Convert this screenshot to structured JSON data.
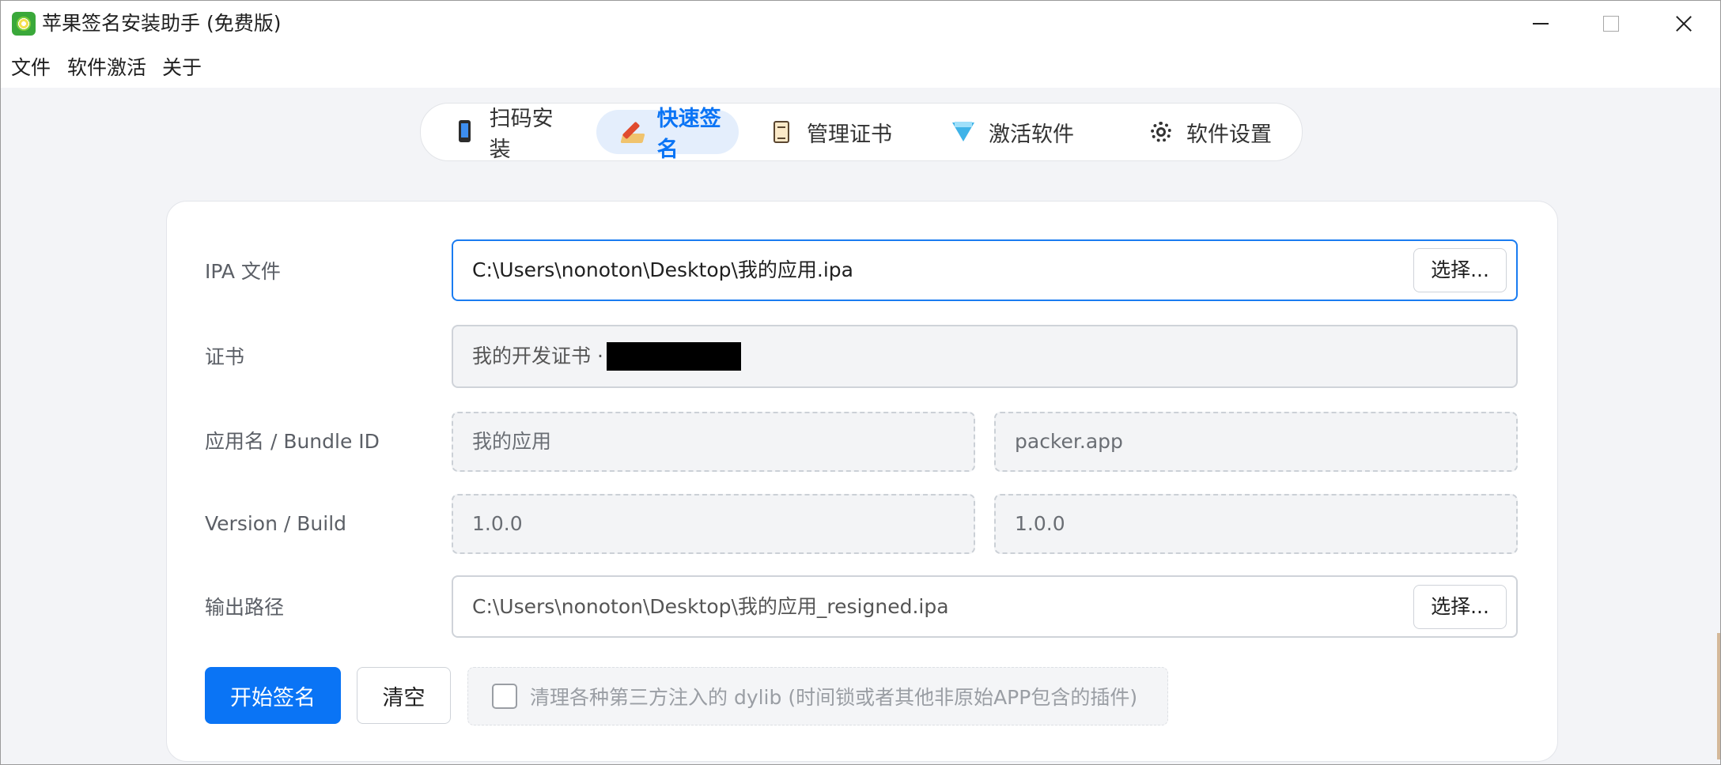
{
  "window": {
    "title": "苹果签名安装助手 (免费版)"
  },
  "menu": [
    "文件",
    "软件激活",
    "关于"
  ],
  "tabs": [
    {
      "label": "扫码安装",
      "icon": "phone-icon",
      "active": false
    },
    {
      "label": "快速签名",
      "icon": "pen-signature-icon",
      "active": true
    },
    {
      "label": "管理证书",
      "icon": "scroll-icon",
      "active": false
    },
    {
      "label": "激活软件",
      "icon": "diamond-icon",
      "active": false
    },
    {
      "label": "软件设置",
      "icon": "gear-icon",
      "active": false
    }
  ],
  "form": {
    "ipa_label": "IPA 文件",
    "ipa_value": "C:\\Users\\nonoton\\Desktop\\我的应用.ipa",
    "choose_label": "选择...",
    "cert_label": "证书",
    "cert_value": "我的开发证书 · ",
    "appname_label": "应用名 / Bundle ID",
    "app_name": "我的应用",
    "bundle_id": "packer.app",
    "version_label": "Version / Build",
    "version": "1.0.0",
    "build": "1.0.0",
    "output_label": "输出路径",
    "output_value": "C:\\Users\\nonoton\\Desktop\\我的应用_resigned.ipa"
  },
  "actions": {
    "start_label": "开始签名",
    "clear_label": "清空",
    "clean_dylib_label": "清理各种第三方注入的 dylib (时间锁或者其他非原始APP包含的插件)",
    "clean_dylib_checked": false
  },
  "colors": {
    "accent": "#0a74f5",
    "active_tab_bg": "#e4eefc"
  }
}
